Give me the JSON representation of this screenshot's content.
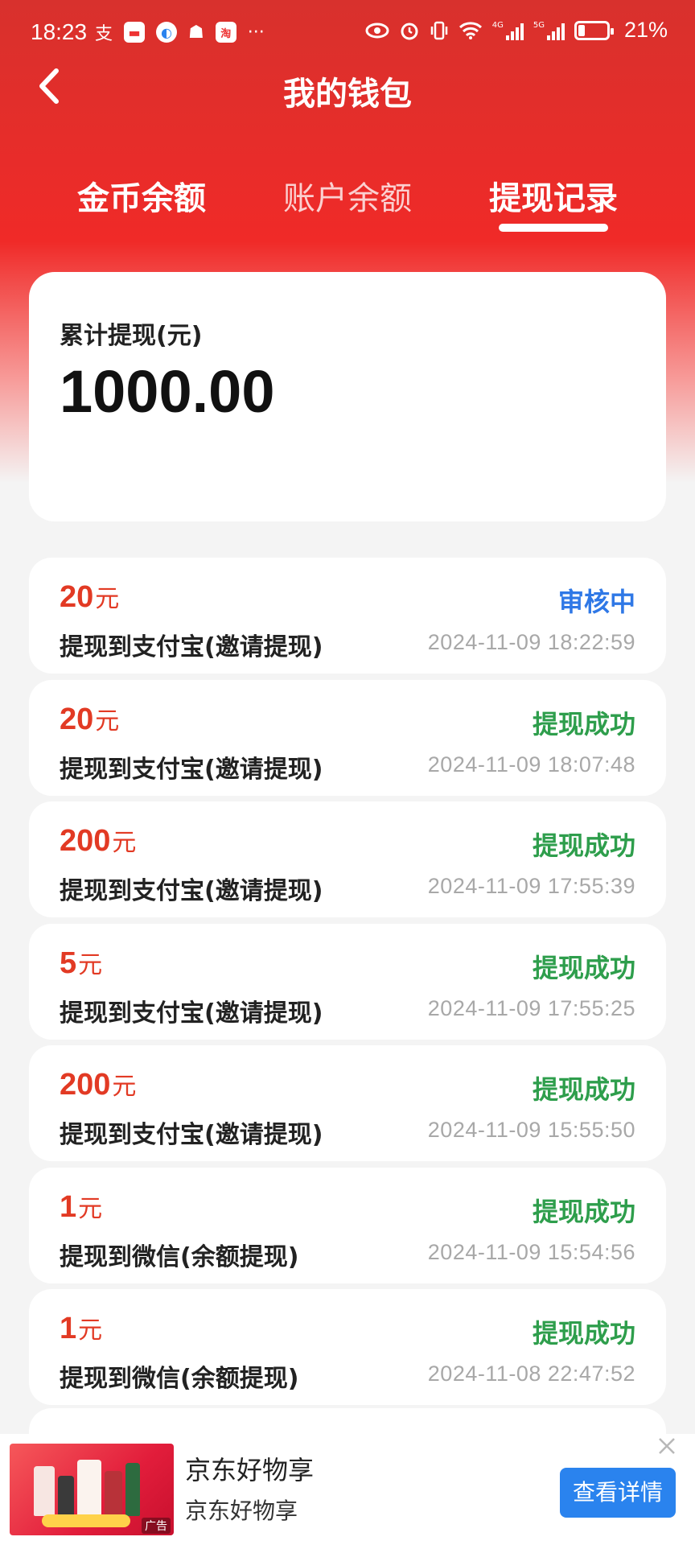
{
  "status_bar": {
    "time": "18:23",
    "battery": "21%",
    "network": [
      "4G",
      "5G"
    ]
  },
  "header": {
    "title": "我的钱包",
    "tabs": [
      "金币余额",
      "账户余额",
      "提现记录"
    ],
    "active_tab": 2
  },
  "summary": {
    "label": "累计提现(元)",
    "value": "1000.00"
  },
  "records": [
    {
      "amount": "20",
      "unit": "元",
      "status": "审核中",
      "status_type": "pending",
      "desc": "提现到支付宝(邀请提现)",
      "time": "2024-11-09 18:22:59"
    },
    {
      "amount": "20",
      "unit": "元",
      "status": "提现成功",
      "status_type": "success",
      "desc": "提现到支付宝(邀请提现)",
      "time": "2024-11-09 18:07:48"
    },
    {
      "amount": "200",
      "unit": "元",
      "status": "提现成功",
      "status_type": "success",
      "desc": "提现到支付宝(邀请提现)",
      "time": "2024-11-09 17:55:39"
    },
    {
      "amount": "5",
      "unit": "元",
      "status": "提现成功",
      "status_type": "success",
      "desc": "提现到支付宝(邀请提现)",
      "time": "2024-11-09 17:55:25"
    },
    {
      "amount": "200",
      "unit": "元",
      "status": "提现成功",
      "status_type": "success",
      "desc": "提现到支付宝(邀请提现)",
      "time": "2024-11-09 15:55:50"
    },
    {
      "amount": "1",
      "unit": "元",
      "status": "提现成功",
      "status_type": "success",
      "desc": "提现到微信(余额提现)",
      "time": "2024-11-09 15:54:56"
    },
    {
      "amount": "1",
      "unit": "元",
      "status": "提现成功",
      "status_type": "success",
      "desc": "提现到微信(余额提现)",
      "time": "2024-11-08 22:47:52"
    }
  ],
  "ad": {
    "title": "京东好物享",
    "subtitle": "京东好物享",
    "cta": "查看详情",
    "mark": "广告"
  },
  "colors": {
    "brand_red": "#f02a28",
    "amount_red": "#e23a24",
    "pending_blue": "#2f78e6",
    "success_green": "#2e9e4c",
    "cta_blue": "#2a83ee"
  }
}
